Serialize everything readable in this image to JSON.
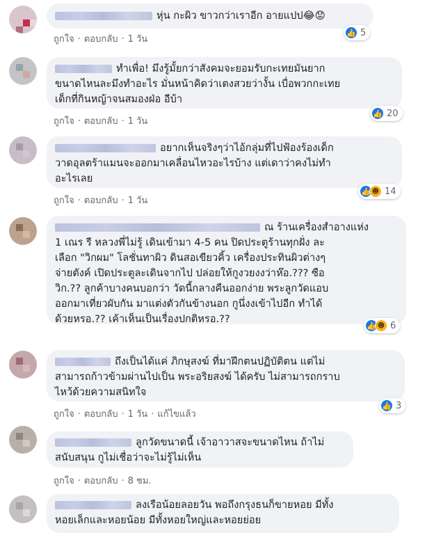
{
  "actions": {
    "like": "ถูกใจ",
    "reply": "ตอบกลับ",
    "edited": "แก้ไขแล้ว",
    "sep": "·"
  },
  "colors": {
    "bubble": "#f0f2f5",
    "like": "#1877f2",
    "haha": "#f7b125",
    "meta": "#606770"
  },
  "comments": [
    {
      "lines": [
        "หุ่น กะผิว ขาวกว่าเราอีก อายแปป😂😟"
      ],
      "time": "1 วัน",
      "reactions": [
        "like-icon"
      ],
      "count": "5"
    },
    {
      "lines": [
        "ทำเพื่อ! มึงรู้มั้ยกว่าสังคมจะยอมรับกะเทยมันยาก",
        "ขนาดไหนละมึงทำอะไร มั่นหน้าคิดว่าเตงสวยว่างั้น เบื่อพวกกะเทย",
        "เด็กที่กินหญ้าจนสมองฝ่อ อีบ้า"
      ],
      "time": "1 วัน",
      "reactions": [
        "like-icon"
      ],
      "count": "20"
    },
    {
      "lines": [
        "อยากเห็นจริงๆว่าไอ้กลุ่มที่ไปฟ้องร้องเด็ก",
        "วาดอุลตร้าแมนจะออกมาเคลื่อนไหวอะไรบ้าง แต่เดาว่าคงไม่ทำ",
        "อะไรเลย"
      ],
      "time": "1 วัน",
      "reactions": [
        "like-icon",
        "haha-icon"
      ],
      "count": "14"
    },
    {
      "lines": [
        "ณ ร้านเครื่องสำอางแห่ง",
        "1 เณร รี หลวงพี่ไม่รู้ เดินเข้ามา 4-5 คน ปิดประตูร้านทุกฝั่ง ละ",
        "เลือก \"วิกผม\" โลชั่นทาผิว ดินสอเขียวคิ้ว เครื่องประทินผิวต่างๆ",
        "จ่ายตังค์ เปิดประตูละเดินจากไป ปล่อยให้กูงวยงงว่าห๊อ.??? ซือ",
        "วิก.?? ลูกค้าบางคนบอกว่า วัดนี้กลางคืนออกง่าย พระลูกวัดแอบ",
        "ออกมาเที่ยวผับกัน มาแต่งตัวกันข้างนอก กูนึ่งงเข้าไปอีก ทำได้",
        "ด้วยหรอ.?? เค้าเห็นเป็นเรื่องปกติหรอ.??"
      ],
      "time": "",
      "reactions": [
        "like-icon",
        "haha-icon"
      ],
      "count": "6"
    },
    {
      "lines": [
        "ถึงเป็นได้แค่ ภิกษุสงฆ์ ที่มาฝึกตนปฏิบัติตน แต่ไม่",
        "สามารถก้าวข้ามผ่านไปเป็น พระอริยสงฆ์ ได้ครับ ไม่สามารถกราบ",
        "ไหว้ด้วยความสนิทใจ"
      ],
      "time": "1 วัน",
      "edited": true,
      "reactions": [
        "like-icon"
      ],
      "count": "3"
    },
    {
      "lines": [
        "ลูกวัดขนาดนี้ เจ้าอาวาสจะขนาดไหน ถ้าไม่",
        "สนับสนุน กูไม่เชื่อว่าจะไม่รู้ไม่เห็น"
      ],
      "time": "8 ชม.",
      "reactions": [],
      "count": ""
    },
    {
      "lines": [
        "ลงเรือน้อยลอยวัน พอถึงกรุงธนก็ขายหอย มีทั้ง",
        "หอยเล็กและหอยน้อย มีทั้งหอยใหญ่และหอยย่อย"
      ],
      "time": "",
      "reactions": [],
      "count": ""
    }
  ]
}
